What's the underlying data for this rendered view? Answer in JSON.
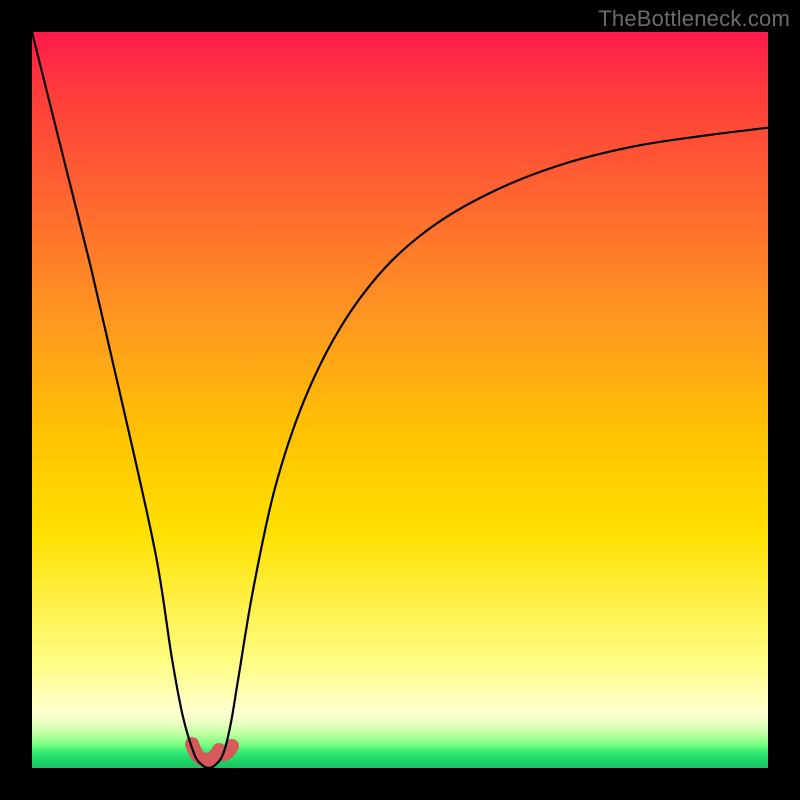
{
  "watermark": "TheBottleneck.com",
  "colors": {
    "frame": "#000000",
    "curve": "#000000",
    "bump": "#d65a5a",
    "gradient_top": "#ff1a4a",
    "gradient_mid": "#ffe100",
    "gradient_bottom": "#18c25f"
  },
  "chart_data": {
    "type": "line",
    "title": "",
    "xlabel": "",
    "ylabel": "",
    "xlim": [
      0,
      100
    ],
    "ylim": [
      0,
      100
    ],
    "grid": false,
    "series": [
      {
        "name": "bottleneck-curve",
        "x": [
          0,
          2,
          5,
          8,
          11,
          14,
          17,
          19,
          20.5,
          22,
          23,
          24,
          25,
          26,
          27,
          28,
          30,
          33,
          37,
          42,
          48,
          55,
          63,
          72,
          82,
          92,
          100
        ],
        "y": [
          100,
          92,
          80,
          68,
          55,
          42,
          28,
          15,
          7,
          2,
          0.5,
          0,
          0.5,
          2,
          6,
          12,
          24,
          38,
          50,
          60,
          68,
          74,
          78.5,
          82,
          84.5,
          86,
          87
        ],
        "note": "Single V-shaped curve; minimum at x≈24. Left branch nearly linear from (0,100) to (24,0); right branch rises with diminishing slope toward ≈87 at x=100. Values read in percent of plot area; no axis ticks shown."
      }
    ],
    "highlight": {
      "name": "min-region-marker",
      "x_range": [
        22,
        27
      ],
      "y": 0.5,
      "color": "#d65a5a",
      "description": "Short thick red-pink U-shaped marker hugging the curve minimum at baseline."
    }
  }
}
